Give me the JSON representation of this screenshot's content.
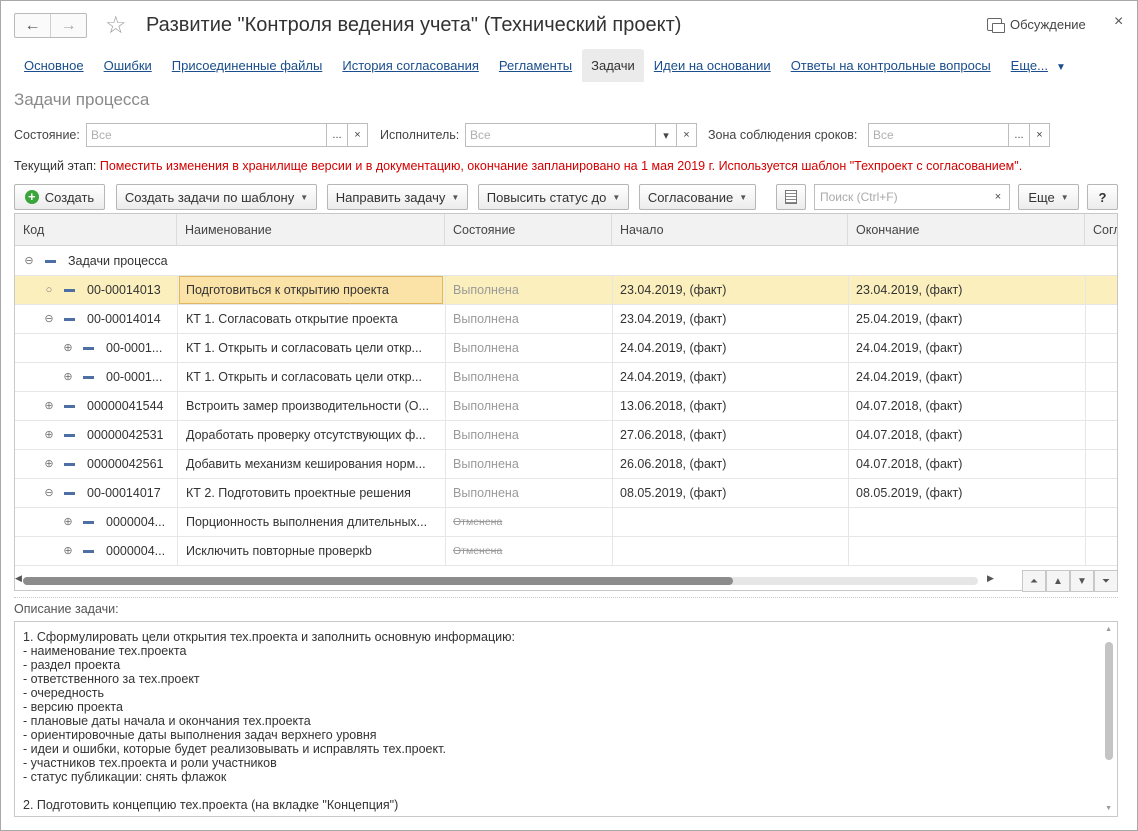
{
  "window": {
    "title": "Развитие \"Контроля ведения учета\" (Технический проект)",
    "back_icon": "←",
    "forward_icon": "→",
    "star_icon": "☆",
    "discuss_label": "Обсуждение",
    "close_icon": "×"
  },
  "tabs": [
    {
      "label": "Основное",
      "active": false
    },
    {
      "label": "Ошибки",
      "active": false
    },
    {
      "label": "Присоединенные файлы",
      "active": false
    },
    {
      "label": "История согласования",
      "active": false
    },
    {
      "label": "Регламенты",
      "active": false
    },
    {
      "label": "Задачи",
      "active": true
    },
    {
      "label": "Идеи на основании",
      "active": false
    },
    {
      "label": "Ответы на контрольные вопросы",
      "active": false
    },
    {
      "label": "Еще...",
      "active": false
    }
  ],
  "section_title": "Задачи процесса",
  "filters": {
    "state_label": "Состояние:",
    "state_placeholder": "Все",
    "executor_label": "Исполнитель:",
    "executor_placeholder": "Все",
    "zone_label": "Зона соблюдения сроков:",
    "zone_placeholder": "Все",
    "dots": "...",
    "clear": "×",
    "drop": "▾"
  },
  "stage": {
    "label": "Текущий этап:",
    "text": "Поместить изменения в хранилище версии и в документацию, окончание запланировано на 1 мая 2019 г. Используется шаблон \"Техпроект с согласованием\"."
  },
  "toolbar": {
    "create": "Создать",
    "create_by_template": "Создать задачи по шаблону",
    "send_task": "Направить задачу",
    "raise_status": "Повысить статус до",
    "approval": "Согласование",
    "search_placeholder": "Поиск (Ctrl+F)",
    "more": "Еще",
    "help": "?"
  },
  "grid": {
    "columns": [
      "Код",
      "Наименование",
      "Состояние",
      "Начало",
      "Окончание",
      "Согл"
    ],
    "group_label": "Задачи процесса",
    "rows": [
      {
        "code": "00-00014013",
        "name": "Подготовиться к открытию проекта",
        "status": "Выполнена",
        "start": "23.04.2019, (факт)",
        "end": "23.04.2019, (факт)",
        "level": 1,
        "toggle": "○",
        "selected": true,
        "cancelled": false
      },
      {
        "code": "00-00014014",
        "name": "КТ 1. Согласовать открытие проекта",
        "status": "Выполнена",
        "start": "23.04.2019, (факт)",
        "end": "25.04.2019, (факт)",
        "level": 1,
        "toggle": "⊖",
        "selected": false,
        "cancelled": false
      },
      {
        "code": "00-0001...",
        "name": "КТ 1. Открыть и согласовать цели откр...",
        "status": "Выполнена",
        "start": "24.04.2019, (факт)",
        "end": "24.04.2019, (факт)",
        "level": 2,
        "toggle": "⊕",
        "selected": false,
        "cancelled": false
      },
      {
        "code": "00-0001...",
        "name": "КТ 1. Открыть и согласовать цели откр...",
        "status": "Выполнена",
        "start": "24.04.2019, (факт)",
        "end": "24.04.2019, (факт)",
        "level": 2,
        "toggle": "⊕",
        "selected": false,
        "cancelled": false
      },
      {
        "code": "00000041544",
        "name": "Встроить замер производительности (О...",
        "status": "Выполнена",
        "start": "13.06.2018, (факт)",
        "end": "04.07.2018, (факт)",
        "level": 1,
        "toggle": "⊕",
        "selected": false,
        "cancelled": false
      },
      {
        "code": "00000042531",
        "name": "Доработать проверку отсутствующих ф...",
        "status": "Выполнена",
        "start": "27.06.2018, (факт)",
        "end": "04.07.2018, (факт)",
        "level": 1,
        "toggle": "⊕",
        "selected": false,
        "cancelled": false
      },
      {
        "code": "00000042561",
        "name": "Добавить механизм кеширования норм...",
        "status": "Выполнена",
        "start": "26.06.2018, (факт)",
        "end": "04.07.2018, (факт)",
        "level": 1,
        "toggle": "⊕",
        "selected": false,
        "cancelled": false
      },
      {
        "code": "00-00014017",
        "name": "КТ 2. Подготовить проектные решения",
        "status": "Выполнена",
        "start": "08.05.2019, (факт)",
        "end": "08.05.2019, (факт)",
        "level": 1,
        "toggle": "⊖",
        "selected": false,
        "cancelled": false
      },
      {
        "code": "0000004...",
        "name": "Порционность выполнения длительных...",
        "status": "Отменена",
        "start": "",
        "end": "",
        "level": 2,
        "toggle": "⊕",
        "selected": false,
        "cancelled": true
      },
      {
        "code": "0000004...",
        "name": "Исключить повторные проверкb",
        "status": "Отменена",
        "start": "",
        "end": "",
        "level": 2,
        "toggle": "⊕",
        "selected": false,
        "cancelled": true
      }
    ]
  },
  "description": {
    "label": "Описание задачи:",
    "text": "1. Сформулировать цели открытия тех.проекта и заполнить основную информацию:\n- наименование тех.проекта\n- раздел проекта\n- ответственного за тех.проект\n- очередность\n- версию проекта\n- плановые даты начала и окончания тех.проекта\n- ориентировочные даты выполнения задач верхнего уровня\n- идеи и ошибки, которые будет реализовывать и исправлять тех.проект.\n- участников тех.проекта и роли участников\n- статус публикации: снять флажок\n\n2. Подготовить концепцию тех.проекта (на вкладке \"Концепция\")"
  },
  "colors": {
    "link": "#1a4e8c",
    "stage_red": "#d40000",
    "selected_row": "#fbefbd",
    "focus_cell": "#fbe3a8",
    "create_green": "#3aa63a"
  }
}
